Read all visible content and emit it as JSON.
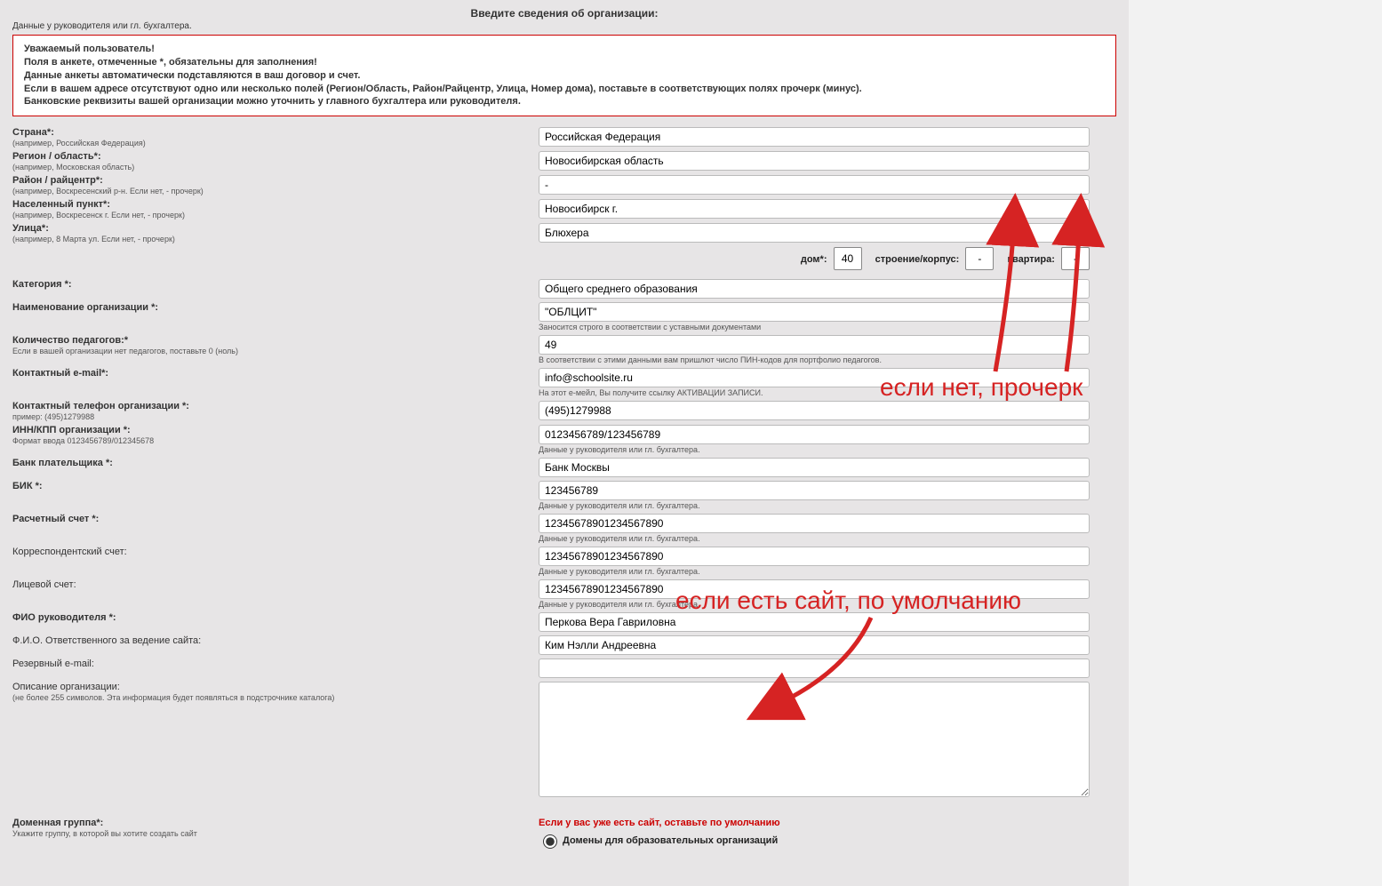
{
  "heading": "Введите сведения об организации:",
  "top_hint": "Данные у руководителя или гл. бухгалтера.",
  "infobox": {
    "l1": "Уважаемый пользователь!",
    "l2": "Поля в анкете, отмеченные *, обязательны для заполнения!",
    "l3": "Данные анкеты автоматически подставляются в ваш договор и счет.",
    "l4": "Если в вашем адресе отсутствуют одно или несколько полей (Регион/Область, Район/Райцентр, Улица, Номер дома), поставьте в соответствующих полях прочерк (минус).",
    "l5": "Банковские реквизиты вашей организации можно уточнить у главного бухгалтера или руководителя."
  },
  "labels": {
    "country": "Страна*:",
    "country_hint": "(например, Российская Федерация)",
    "region": "Регион / область*:",
    "region_hint": "(например, Московская область)",
    "district": "Район / райцентр*:",
    "district_hint": "(например, Воскресенский р-н. Если нет, - прочерк)",
    "city": "Населенный пункт*:",
    "city_hint": "(например, Воскресенск г. Если нет, - прочерк)",
    "street": "Улица*:",
    "street_hint": "(например, 8 Марта ул. Если нет, - прочерк)",
    "house": "дом*:",
    "building": "строение/корпус:",
    "apt": "квартира:",
    "category": "Категория *:",
    "orgname": "Наименование организации *:",
    "orgname_under": "Заносится строго в соответствии с уставными документами",
    "teachers": "Количество педагогов:*",
    "teachers_hint": "Если в вашей организации нет педагогов, поставьте 0 (ноль)",
    "teachers_under": "В соответствии с этими данными вам пришлют число ПИН-кодов для портфолио педагогов.",
    "email": "Контактный e-mail*:",
    "email_under": "На этот е-мейл, Вы получите ссылку АКТИВАЦИИ ЗАПИСИ.",
    "phone": "Контактный телефон организации *:",
    "phone_hint": "пример: (495)1279988",
    "inn": "ИНН/КПП организации *:",
    "inn_hint": "Формат ввода 0123456789/012345678",
    "inn_under": "Данные у руководителя или гл. бухгалтера.",
    "bank": "Банк плательщика *:",
    "bik": "БИК *:",
    "bik_under": "Данные у руководителя или гл. бухгалтера.",
    "rs": "Расчетный счет *:",
    "rs_under": "Данные у руководителя или гл. бухгалтера.",
    "ks": "Корреспондентский счет:",
    "ks_under": "Данные у руководителя или гл. бухгалтера.",
    "ls": "Лицевой счет:",
    "ls_under": "Данные у руководителя или гл. бухгалтера.",
    "director": "ФИО руководителя *:",
    "responsible": "Ф.И.О. Ответственного за ведение сайта:",
    "reserve_email": "Резервный e-mail:",
    "description": "Описание организации:",
    "description_hint": "(не более 255 символов. Эта информация будет появляться в подстрочнике каталога)",
    "domain_group": "Доменная группа*:",
    "domain_group_hint": "Укажите группу, в которой вы хотите создать сайт",
    "domain_note": "Если у вас уже есть сайт, оставьте по умолчанию",
    "domain_opt1": "Домены для образовательных организаций"
  },
  "values": {
    "country": "Российская Федерация",
    "region": "Новосибирская область",
    "district": "-",
    "city": "Новосибирск г.",
    "street": "Блюхера",
    "house": "40",
    "building": "-",
    "apt": "-",
    "category": "Общего среднего образования",
    "orgname": "\"ОБЛЦИТ\"",
    "teachers": "49",
    "email": "info@schoolsite.ru",
    "phone": "(495)1279988",
    "inn": "0123456789/123456789",
    "bank": "Банк Москвы",
    "bik": "123456789",
    "rs": "12345678901234567890",
    "ks": "12345678901234567890",
    "ls": "12345678901234567890",
    "director": "Перкова Вера Гавриловна",
    "responsible": "Ким Нэлли Андреевна",
    "reserve_email": "",
    "description": ""
  },
  "annotations": {
    "a1": "если нет, прочерк",
    "a2": "если есть сайт, по умолчанию"
  }
}
